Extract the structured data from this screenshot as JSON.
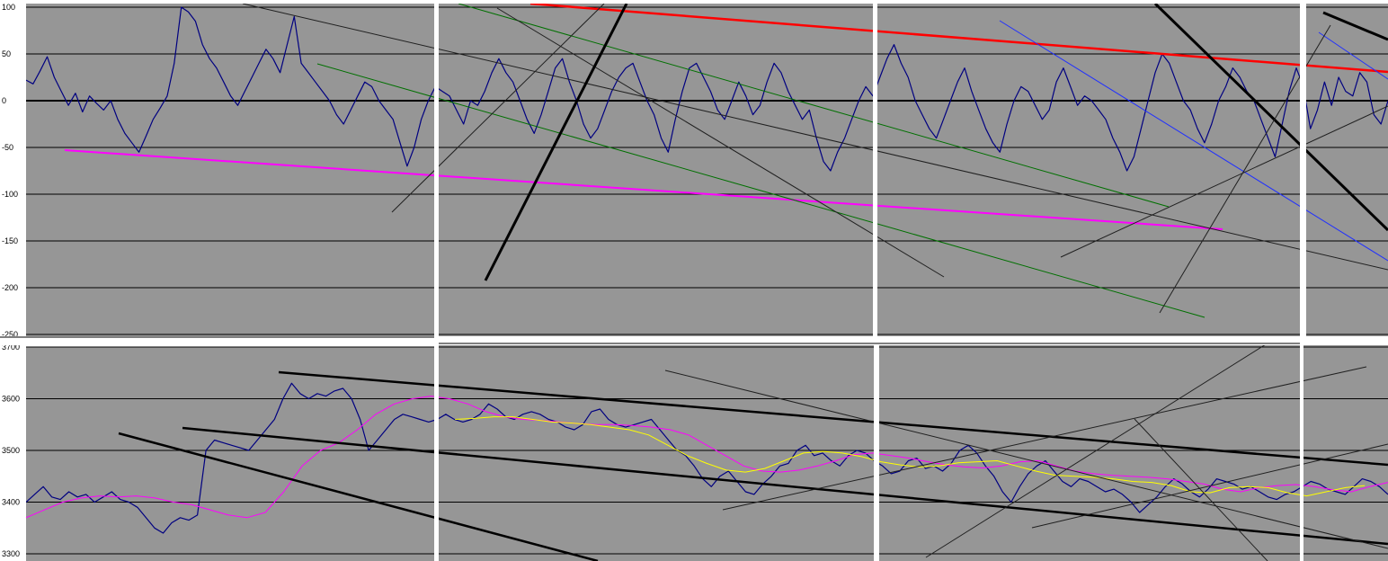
{
  "chart_data": [
    {
      "type": "line",
      "name_key": "oscillator",
      "ylim": [
        -250,
        100
      ],
      "yticks": [
        "100",
        "50",
        "0",
        "-50",
        "-100",
        "-150",
        "-200",
        "-250"
      ],
      "ytick_values": [
        100,
        50,
        0,
        -50,
        -100,
        -150,
        -200,
        -250
      ],
      "grid": true,
      "zero_line": true,
      "background": "#969696",
      "series": [
        {
          "color": "#000080",
          "values": [
            22,
            18,
            32,
            47,
            25,
            10,
            -5,
            8,
            -12,
            5,
            -3,
            -10,
            0,
            -20,
            -35,
            -45,
            -55,
            -38,
            -20,
            -8,
            5,
            40,
            100,
            95,
            85,
            60,
            45,
            35,
            20,
            5,
            -5,
            10,
            25,
            40,
            55,
            45,
            30,
            60,
            90,
            40,
            30,
            20,
            10,
            0,
            -15,
            -25,
            -10,
            5,
            20,
            15,
            0,
            -10,
            -20,
            -45,
            -70,
            -50,
            -20,
            0,
            15,
            10,
            5,
            -10,
            -25,
            0,
            -5,
            10,
            30,
            45,
            30,
            20,
            0,
            -20,
            -35,
            -15,
            10,
            35,
            45,
            20,
            0,
            -25,
            -40,
            -30,
            -10,
            10,
            25,
            35,
            40,
            20,
            0,
            -15,
            -40,
            -55,
            -20,
            10,
            35,
            40,
            25,
            10,
            -10,
            -20,
            0,
            20,
            5,
            -15,
            -5,
            20,
            40,
            30,
            10,
            -5,
            -20,
            -10,
            -40,
            -65,
            -75,
            -55,
            -40,
            -20,
            0,
            15,
            5,
            25,
            45,
            60,
            40,
            25,
            0,
            -15,
            -30,
            -40,
            -20,
            0,
            20,
            35,
            10,
            -10,
            -30,
            -45,
            -55,
            -25,
            0,
            15,
            10,
            -5,
            -20,
            -10,
            20,
            35,
            15,
            -5,
            5,
            0,
            -10,
            -20,
            -40,
            -55,
            -75,
            -60,
            -30,
            0,
            30,
            50,
            40,
            20,
            0,
            -10,
            -30,
            -45,
            -25,
            0,
            15,
            35,
            25,
            10,
            0,
            -20,
            -40,
            -60,
            -25,
            10,
            35,
            15,
            -30,
            -10,
            20,
            -5,
            25,
            10,
            5,
            30,
            20,
            -15,
            -25,
            0
          ],
          "x_range": [
            0,
            1
          ]
        }
      ]
    },
    {
      "type": "line",
      "name_key": "price",
      "ylim": [
        3300,
        3700
      ],
      "yticks": [
        "3700",
        "3600",
        "3500",
        "3400",
        "3300"
      ],
      "ytick_values": [
        3700,
        3600,
        3500,
        3400,
        3300
      ],
      "grid": true,
      "background": "#969696",
      "series": [
        {
          "color": "#000080",
          "values": [
            3400,
            3415,
            3430,
            3410,
            3405,
            3420,
            3410,
            3415,
            3400,
            3410,
            3420,
            3405,
            3400,
            3390,
            3370,
            3350,
            3340,
            3360,
            3370,
            3365,
            3375,
            3500,
            3520,
            3515,
            3510,
            3505,
            3500,
            3520,
            3540,
            3560,
            3600,
            3630,
            3610,
            3600,
            3610,
            3605,
            3615,
            3620,
            3600,
            3560,
            3500,
            3520,
            3540,
            3560,
            3570,
            3565,
            3560,
            3555,
            3560,
            3570,
            3560,
            3555,
            3560,
            3570,
            3590,
            3580,
            3565,
            3560,
            3570,
            3575,
            3570,
            3560,
            3555,
            3545,
            3540,
            3550,
            3575,
            3580,
            3560,
            3550,
            3545,
            3550,
            3555,
            3560,
            3540,
            3520,
            3500,
            3490,
            3470,
            3445,
            3430,
            3450,
            3460,
            3440,
            3420,
            3415,
            3435,
            3450,
            3470,
            3475,
            3500,
            3510,
            3490,
            3495,
            3480,
            3470,
            3490,
            3500,
            3495,
            3480,
            3470,
            3455,
            3460,
            3480,
            3485,
            3465,
            3470,
            3460,
            3475,
            3500,
            3510,
            3495,
            3470,
            3450,
            3420,
            3400,
            3430,
            3455,
            3470,
            3480,
            3460,
            3440,
            3430,
            3445,
            3440,
            3430,
            3420,
            3425,
            3415,
            3400,
            3380,
            3395,
            3410,
            3430,
            3445,
            3435,
            3420,
            3410,
            3425,
            3445,
            3440,
            3435,
            3425,
            3430,
            3420,
            3410,
            3405,
            3415,
            3420,
            3430,
            3440,
            3435,
            3425,
            3420,
            3415,
            3430,
            3445,
            3440,
            3430,
            3415
          ],
          "x_range": [
            0,
            1
          ]
        },
        {
          "color": "#ff00ff",
          "values": [
            3370,
            3385,
            3400,
            3408,
            3412,
            3410,
            3412,
            3408,
            3400,
            3395,
            3385,
            3375,
            3370,
            3380,
            3420,
            3470,
            3500,
            3515,
            3540,
            3570,
            3590,
            3600,
            3605,
            3600,
            3590,
            3575,
            3565,
            3560,
            3558,
            3555,
            3552,
            3550,
            3550,
            3548,
            3545,
            3540,
            3530,
            3510,
            3490,
            3470,
            3460,
            3458,
            3462,
            3470,
            3480,
            3492,
            3495,
            3490,
            3485,
            3478,
            3472,
            3468,
            3466,
            3470,
            3478,
            3480,
            3470,
            3460,
            3455,
            3452,
            3450,
            3448,
            3445,
            3440,
            3435,
            3425,
            3420,
            3428,
            3432,
            3434,
            3430,
            3424,
            3420,
            3430,
            3438
          ],
          "x_range": [
            0,
            1
          ]
        },
        {
          "color": "#ffff00",
          "values": [
            3560,
            3562,
            3565,
            3565,
            3560,
            3555,
            3553,
            3550,
            3545,
            3540,
            3530,
            3510,
            3490,
            3475,
            3462,
            3458,
            3465,
            3480,
            3495,
            3498,
            3495,
            3488,
            3478,
            3472,
            3468,
            3470,
            3476,
            3478,
            3480,
            3470,
            3460,
            3452,
            3450,
            3448,
            3445,
            3440,
            3438,
            3432,
            3420,
            3418,
            3428,
            3430,
            3428,
            3418,
            3412,
            3420,
            3428,
            3432
          ],
          "x_range": [
            0.315,
            0.983
          ]
        }
      ]
    }
  ]
}
